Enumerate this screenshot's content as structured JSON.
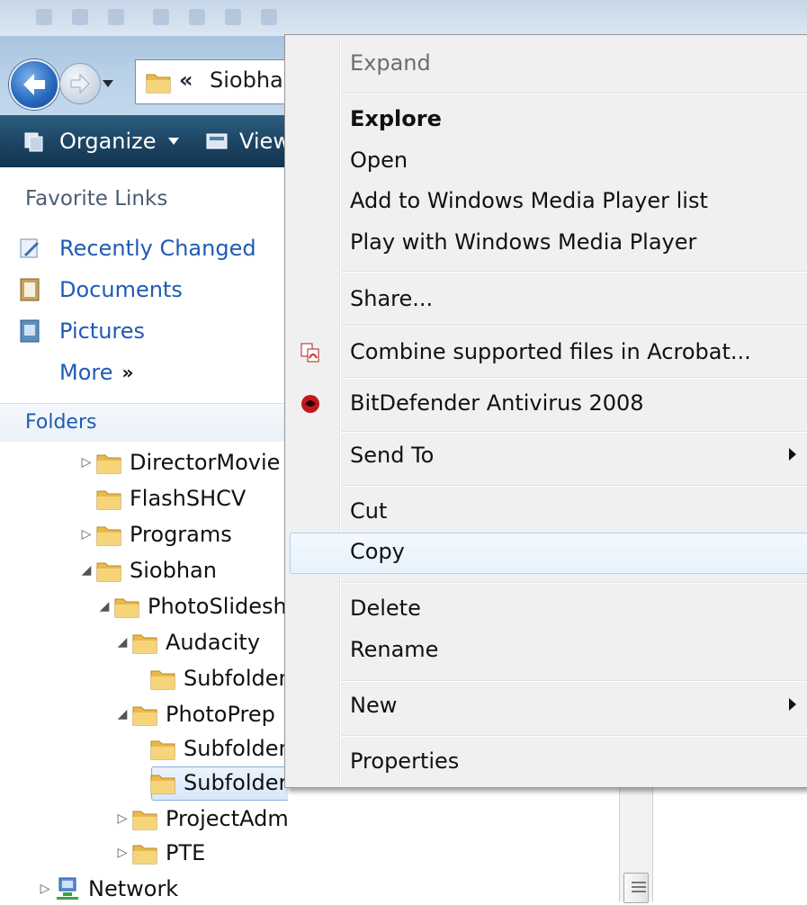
{
  "address": {
    "separator": "«",
    "crumb": "Siobhan"
  },
  "toolbar": {
    "organize": "Organize",
    "views": "Views"
  },
  "nav": {
    "favorites_title": "Favorite Links",
    "favorites": [
      {
        "label": "Recently Changed",
        "icon": "recent-icon"
      },
      {
        "label": "Documents",
        "icon": "documents-icon"
      },
      {
        "label": "Pictures",
        "icon": "pictures-icon"
      },
      {
        "label": "More",
        "icon": "more-chevron-icon"
      }
    ],
    "more_glyph": "»",
    "folders_title": "Folders"
  },
  "tree": [
    {
      "label": "DirectorMovie",
      "expander": "▷"
    },
    {
      "label": "FlashSHCV",
      "expander": ""
    },
    {
      "label": "Programs",
      "expander": "▷"
    },
    {
      "label": "Siobhan",
      "expander": "◢"
    },
    {
      "label": "PhotoSlideshow",
      "expander": "◢"
    },
    {
      "label": "Audacity",
      "expander": "◢"
    },
    {
      "label": "Subfolder",
      "expander": ""
    },
    {
      "label": "PhotoPrep",
      "expander": "◢"
    },
    {
      "label": "Subfolder",
      "expander": ""
    },
    {
      "label": "Subfolder",
      "expander": ""
    },
    {
      "label": "ProjectAdmin",
      "expander": "▷"
    },
    {
      "label": "PTE",
      "expander": "▷"
    },
    {
      "label": "Network",
      "expander": "▷"
    }
  ],
  "context_menu": {
    "items": [
      {
        "label": "Expand",
        "disabled": true
      },
      {
        "label": "Explore",
        "bold": true
      },
      {
        "label": "Open"
      },
      {
        "label": "Add to Windows Media Player list"
      },
      {
        "label": "Play with Windows Media Player"
      },
      {
        "label": "Share..."
      },
      {
        "label": "Combine supported files in Acrobat...",
        "icon": "acrobat-icon"
      },
      {
        "label": "BitDefender Antivirus 2008",
        "icon": "bitdefender-icon"
      },
      {
        "label": "Send To",
        "submenu": true
      },
      {
        "label": "Cut"
      },
      {
        "label": "Copy",
        "highlighted": true
      },
      {
        "label": "Delete"
      },
      {
        "label": "Rename"
      },
      {
        "label": "New",
        "submenu": true
      },
      {
        "label": "Properties"
      }
    ]
  },
  "colors": {
    "link": "#1f5bb4",
    "toolbar": "#1d4665",
    "highlight_border": "#a9d3f0"
  }
}
